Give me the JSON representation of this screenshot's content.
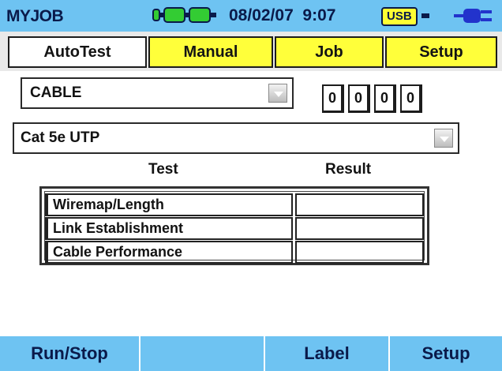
{
  "header": {
    "title": "MYJOB",
    "date": "08/02/07",
    "time": "9:07",
    "usb_label": "USB",
    "battery_icon": "battery-icon",
    "power_icon": "ac-power-plug-icon",
    "bar_color": "#6ec3f2"
  },
  "tabs": [
    {
      "label": "AutoTest",
      "active": true
    },
    {
      "label": "Manual",
      "active": false
    },
    {
      "label": "Job",
      "active": false
    },
    {
      "label": "Setup",
      "active": false
    }
  ],
  "test_type": {
    "selected": "CABLE"
  },
  "counter": {
    "digits": [
      "0",
      "0",
      "0",
      "0"
    ]
  },
  "cable_type": {
    "selected": "Cat 5e UTP"
  },
  "table": {
    "headers": {
      "test": "Test",
      "result": "Result"
    },
    "rows": [
      {
        "test": "Wiremap/Length",
        "result": ""
      },
      {
        "test": "Link Establishment",
        "result": ""
      },
      {
        "test": "Cable Performance",
        "result": ""
      }
    ]
  },
  "softkeys": [
    {
      "label": "Run/Stop"
    },
    {
      "label": ""
    },
    {
      "label": "Label"
    },
    {
      "label": "Setup"
    }
  ],
  "colors": {
    "accent_blue": "#6ec3f2",
    "tab_yellow": "#ffff3a",
    "text_dark": "#0a1a4a"
  }
}
